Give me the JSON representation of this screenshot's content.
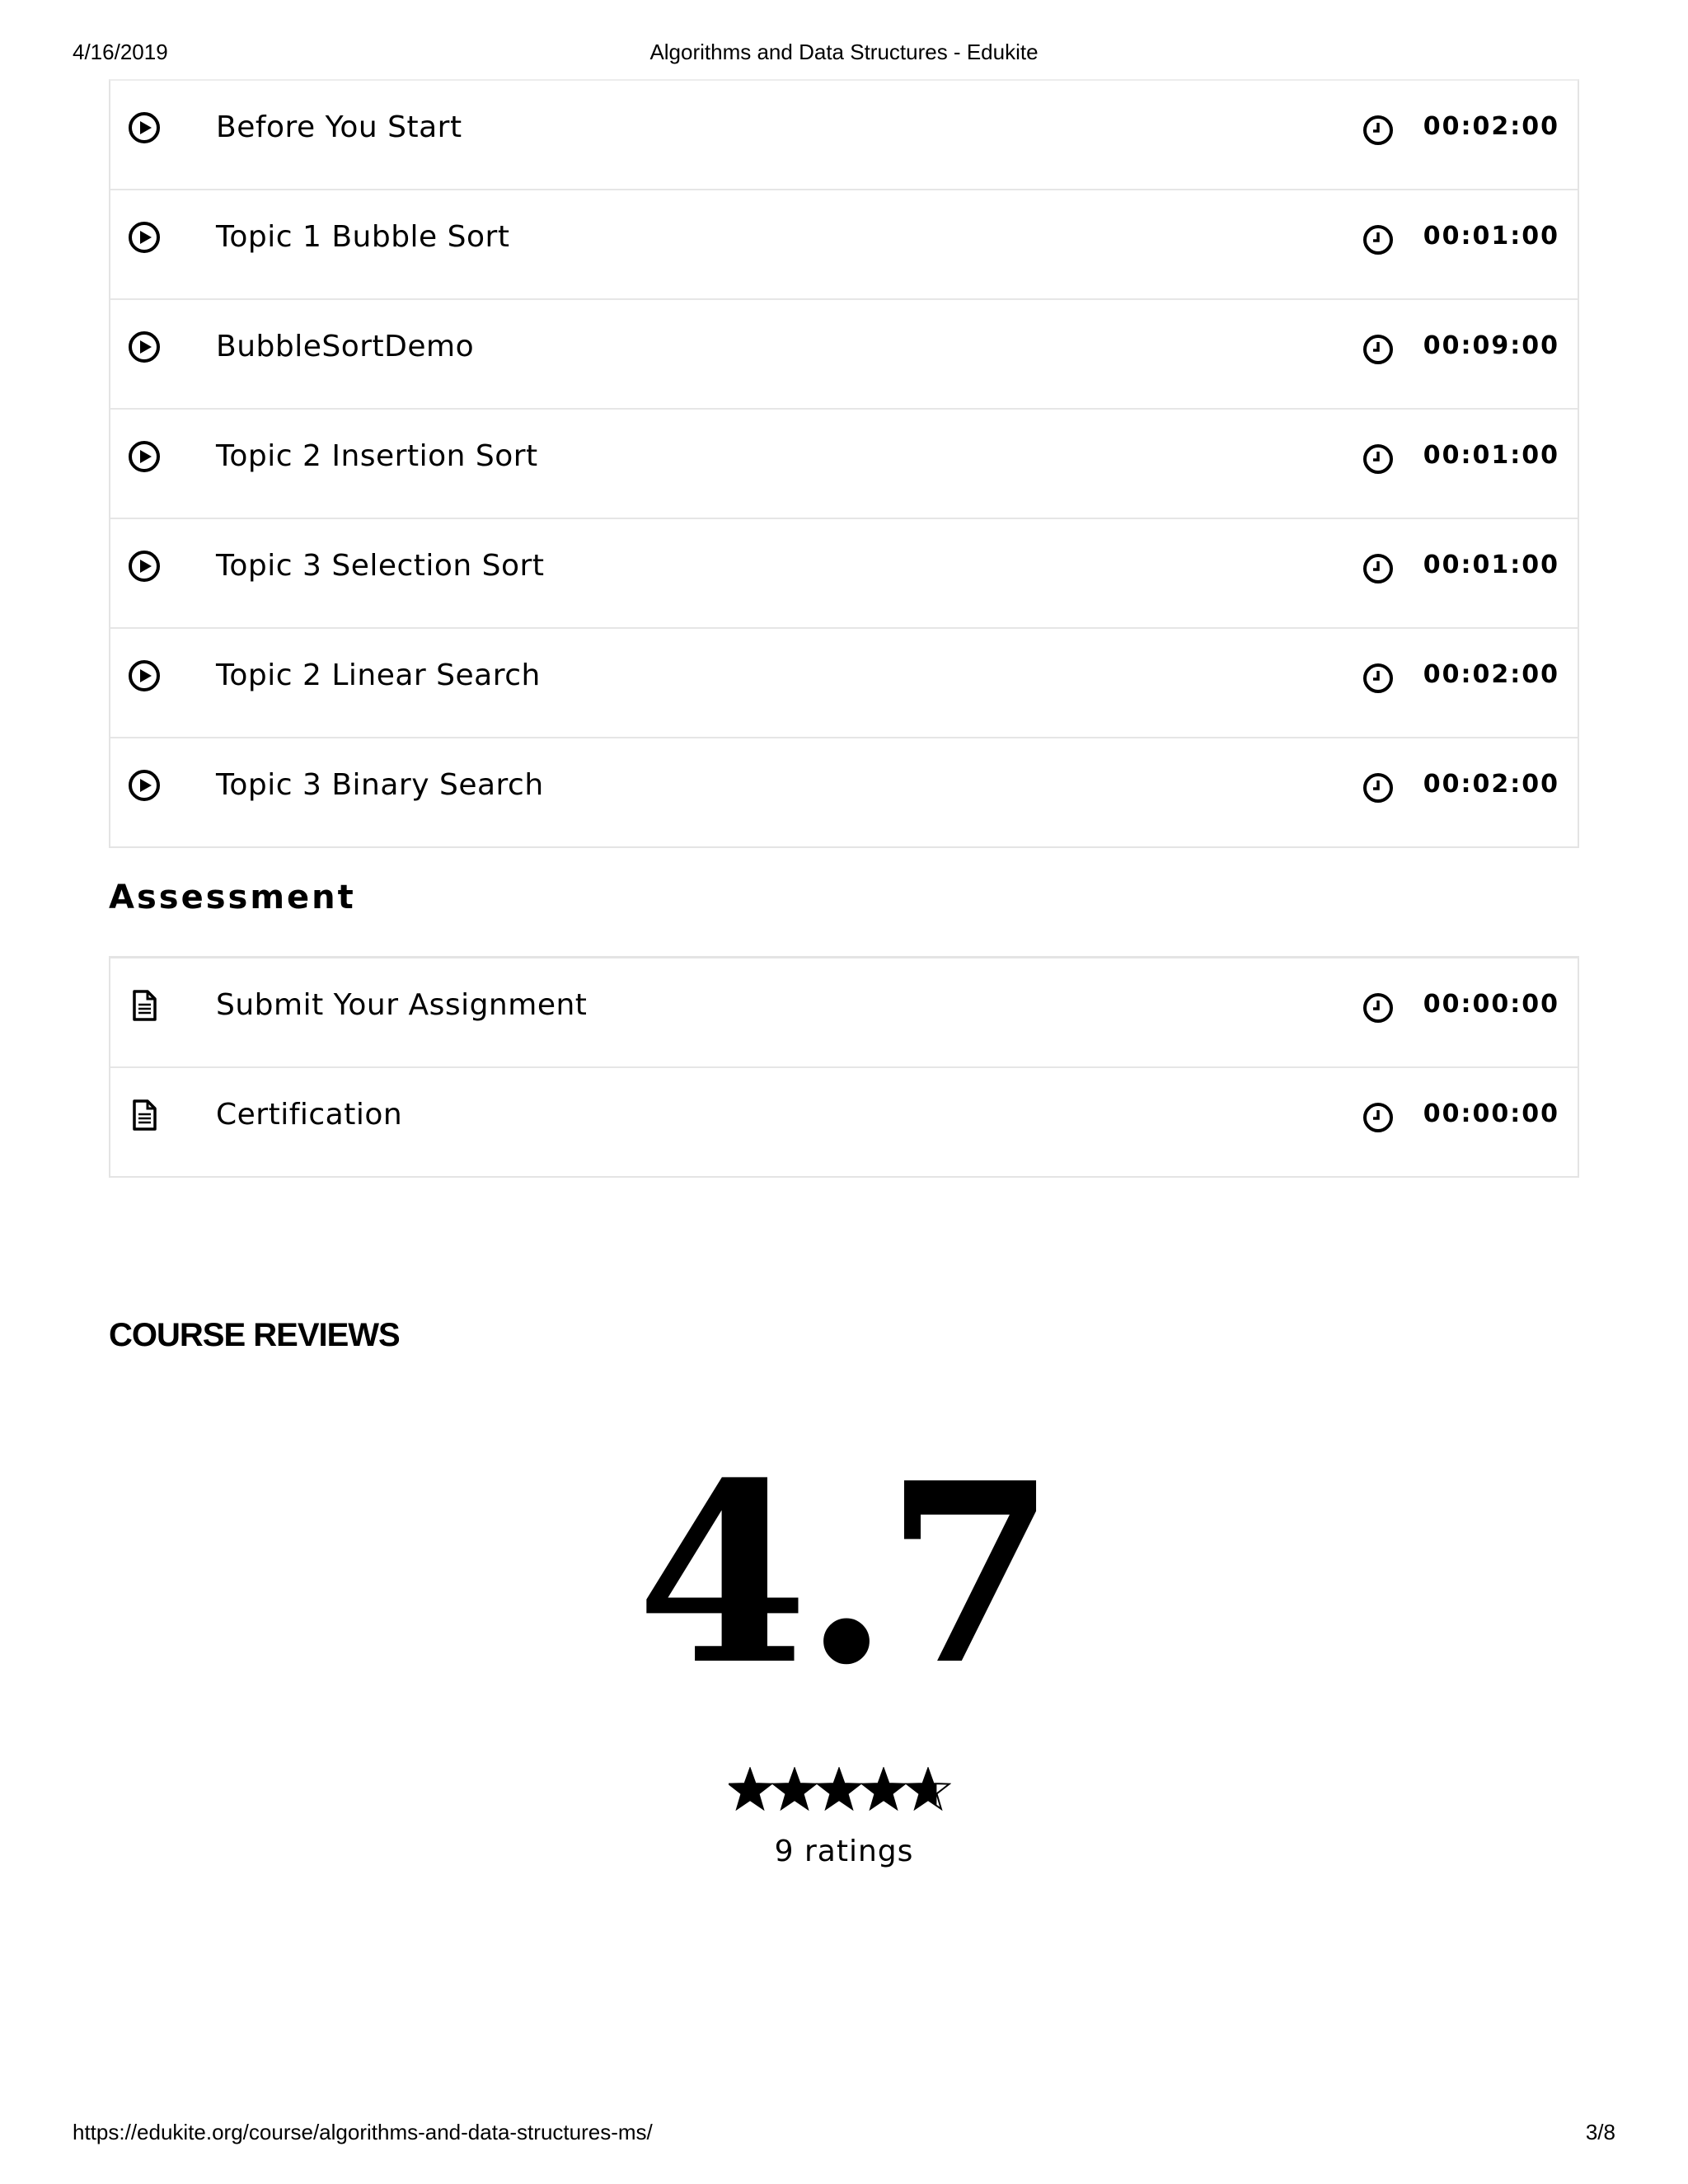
{
  "print_header": {
    "date": "4/16/2019",
    "title": "Algorithms and Data Structures - Edukite"
  },
  "lessons": [
    {
      "title": "Before You Start",
      "duration": "00:02:00",
      "icon": "play-circle-icon"
    },
    {
      "title": "Topic 1 Bubble Sort",
      "duration": "00:01:00",
      "icon": "play-circle-icon"
    },
    {
      "title": "BubbleSortDemo",
      "duration": "00:09:00",
      "icon": "play-circle-icon"
    },
    {
      "title": "Topic 2 Insertion Sort",
      "duration": "00:01:00",
      "icon": "play-circle-icon"
    },
    {
      "title": "Topic 3 Selection Sort",
      "duration": "00:01:00",
      "icon": "play-circle-icon"
    },
    {
      "title": "Topic 2 Linear Search",
      "duration": "00:02:00",
      "icon": "play-circle-icon"
    },
    {
      "title": "Topic 3 Binary Search",
      "duration": "00:02:00",
      "icon": "play-circle-icon"
    }
  ],
  "assessment": {
    "title": "Assessment",
    "items": [
      {
        "title": "Submit Your Assignment",
        "duration": "00:00:00",
        "icon": "document-icon"
      },
      {
        "title": "Certification",
        "duration": "00:00:00",
        "icon": "document-icon"
      }
    ]
  },
  "reviews": {
    "title": "COURSE REVIEWS",
    "rating": "4.7",
    "stars_value": 4.7,
    "stars_max": 5,
    "ratings_count": "9 ratings"
  },
  "print_footer": {
    "url": "https://edukite.org/course/algorithms-and-data-structures-ms/",
    "page": "3/8"
  }
}
